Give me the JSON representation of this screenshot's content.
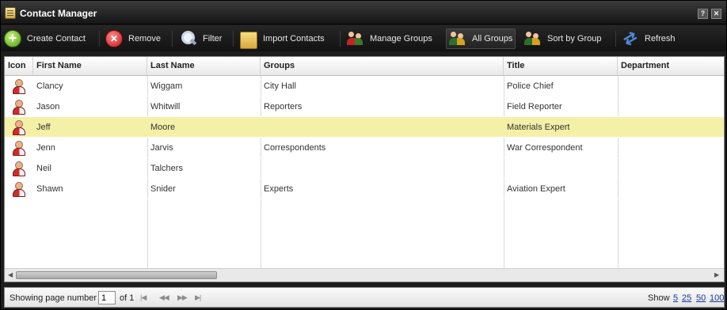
{
  "window": {
    "title": "Contact Manager"
  },
  "toolbar": {
    "create": "Create Contact",
    "remove": "Remove",
    "filter": "Filter",
    "import": "Import Contacts",
    "manage_groups": "Manage Groups",
    "all_groups": "All Groups",
    "sort_by_group": "Sort by Group",
    "refresh": "Refresh"
  },
  "grid": {
    "columns": [
      "Icon",
      "First Name",
      "Last Name",
      "Groups",
      "Title",
      "Department"
    ],
    "rows": [
      {
        "first": "Clancy",
        "last": "Wiggam",
        "groups": "City Hall",
        "title": "Police Chief",
        "department": ""
      },
      {
        "first": "Jason",
        "last": "Whitwill",
        "groups": "Reporters",
        "title": "Field Reporter",
        "department": ""
      },
      {
        "first": "Jeff",
        "last": "Moore",
        "groups": "",
        "title": "Materials Expert",
        "department": ""
      },
      {
        "first": "Jenn",
        "last": "Jarvis",
        "groups": "Correspondents",
        "title": "War Correspondent",
        "department": ""
      },
      {
        "first": "Neil",
        "last": "Talchers",
        "groups": "",
        "title": "",
        "department": ""
      },
      {
        "first": "Shawn",
        "last": "Snider",
        "groups": "Experts",
        "title": "Aviation Expert",
        "department": ""
      }
    ],
    "selected_row": 2
  },
  "pager": {
    "showing_label": "Showing page number",
    "page_value": "1",
    "of_label": "of 1",
    "show_label": "Show",
    "sizes": [
      "5",
      "25",
      "50",
      "100"
    ]
  }
}
